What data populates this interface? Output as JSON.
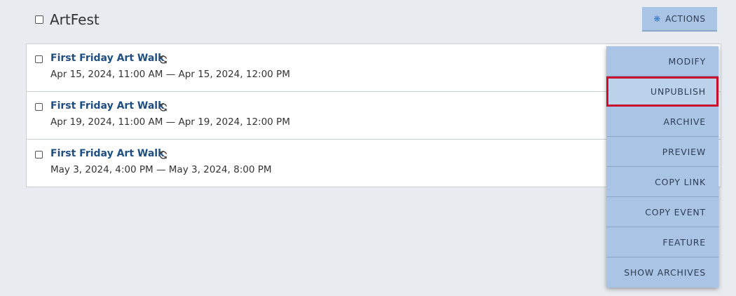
{
  "header": {
    "title": "ArtFest"
  },
  "actions": {
    "label": "ACTIONS",
    "icon": "gear-icon"
  },
  "events": [
    {
      "title": "First Friday Art Walk",
      "dates": "Apr 15, 2024, 11:00 AM — Apr 15, 2024, 12:00 PM",
      "recurring_icon": "recurring-icon"
    },
    {
      "title": "First Friday Art Walk",
      "dates": "Apr 19, 2024, 11:00 AM — Apr 19, 2024, 12:00 PM",
      "recurring_icon": "recurring-icon"
    },
    {
      "title": "First Friday Art Walk",
      "dates": "May 3, 2024, 4:00 PM — May 3, 2024, 8:00 PM",
      "recurring_icon": "recurring-icon"
    }
  ],
  "menu": {
    "items": [
      "MODIFY",
      "UNPUBLISH",
      "ARCHIVE",
      "PREVIEW",
      "COPY LINK",
      "COPY EVENT",
      "FEATURE",
      "SHOW ARCHIVES"
    ],
    "highlighted": "UNPUBLISH"
  },
  "colors": {
    "background": "#e8ecf0",
    "accent": "#a9c4e4",
    "link": "#1f4e82",
    "highlight_border": "#c8102e"
  }
}
